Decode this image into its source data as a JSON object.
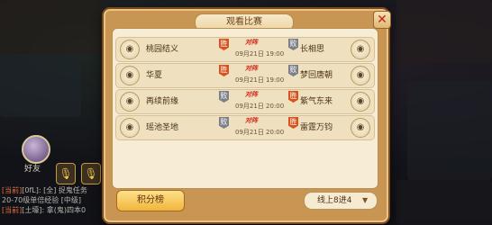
{
  "dialog": {
    "title": "观看比赛",
    "close_label": "✕",
    "vs_text": "对阵",
    "matches": [
      {
        "left_team": "桃园结义",
        "left_result": "胜",
        "right_team": "长相思",
        "right_result": "败",
        "time": "09月21日 19:00"
      },
      {
        "left_team": "华夏",
        "left_result": "胜",
        "right_team": "梦回唐朝",
        "right_result": "败",
        "time": "09月21日 19:00"
      },
      {
        "left_team": "再续前缘",
        "left_result": "败",
        "right_team": "紫气东来",
        "right_result": "胜",
        "time": "09月21日 20:00"
      },
      {
        "left_team": "瑶池圣地",
        "left_result": "败",
        "right_team": "雷霆万钧",
        "right_result": "胜",
        "time": "09月21日 20:00"
      }
    ],
    "rank_button": "积分榜",
    "server_select": {
      "value": "线上8进4"
    }
  },
  "sidebar": {
    "friend_label": "好友",
    "chat_lines": [
      {
        "tag": "[当前]",
        "text": "[0fL]: [全] 捉鬼任务"
      },
      {
        "tag": "",
        "text": "20-70级单倍经验 [中级]"
      },
      {
        "tag": "[当前]",
        "text": "[土壕]: 拿(鬼)四本0"
      }
    ]
  },
  "colors": {
    "win": "#d7521c",
    "lose": "#7d8088",
    "vs": "#d6281c",
    "dialog_frame": "#c89553",
    "button": "#f0b53d"
  },
  "icons": [
    "eye-icon",
    "close-icon",
    "chevron-down-icon",
    "mic-icon",
    "avatar"
  ]
}
